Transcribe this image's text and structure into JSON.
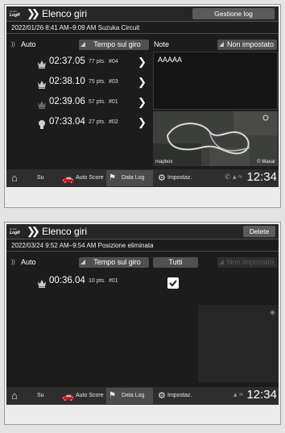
{
  "logo": {
    "top": "Honda",
    "bottom": "LogR"
  },
  "screen1": {
    "title": "Elenco giri",
    "header_button": "Gestione log",
    "subtitle": "2022/01/26 8:41 AM–9:09 AM Suzuka Circuit",
    "mode_label": "Auto",
    "sort_button": "Tempo sul giro",
    "note_label": "Note",
    "note_button": "Non impostato",
    "note_text": "AAAAA",
    "map_labels": {
      "brand": "mapbox",
      "attribution": "© Maxar"
    },
    "laps": [
      {
        "time": "02:37.05",
        "pts": "77 pts.",
        "num": "#04",
        "icon": "crown-icon",
        "color": "#c8c8c8"
      },
      {
        "time": "02:38.10",
        "pts": "75 pts.",
        "num": "#03",
        "icon": "crown-icon",
        "color": "#c8c8c8"
      },
      {
        "time": "02:39.06",
        "pts": "57 pts.",
        "num": "#01",
        "icon": "crown-icon",
        "color": "#6a6a6a"
      },
      {
        "time": "07:33.04",
        "pts": "27 pts.",
        "num": "#02",
        "icon": "medal-icon",
        "color": "#d0d0d0"
      }
    ],
    "footer": {
      "home": "",
      "su": "Su",
      "auto_score": "Auto Score",
      "data_log": "Data Log",
      "settings": "Impostaz."
    },
    "clock": "12:34"
  },
  "screen2": {
    "title": "Elenco giri",
    "header_button": "Delete",
    "subtitle": "2022/03/24 9:52 AM–9:54 AM Posizione eliminata",
    "mode_label": "Auto",
    "sort_button": "Tempo sul giro",
    "all_button": "Tutti",
    "note_button": "Non impostato",
    "laps": [
      {
        "time": "00:36.04",
        "pts": "10 pts.",
        "num": "#01",
        "icon": "crown-icon",
        "checked": true
      }
    ],
    "footer": {
      "home": "",
      "su": "Su",
      "auto_score": "Auto Score",
      "data_log": "Data Log",
      "settings": "Impostaz."
    },
    "clock": "12:34"
  }
}
